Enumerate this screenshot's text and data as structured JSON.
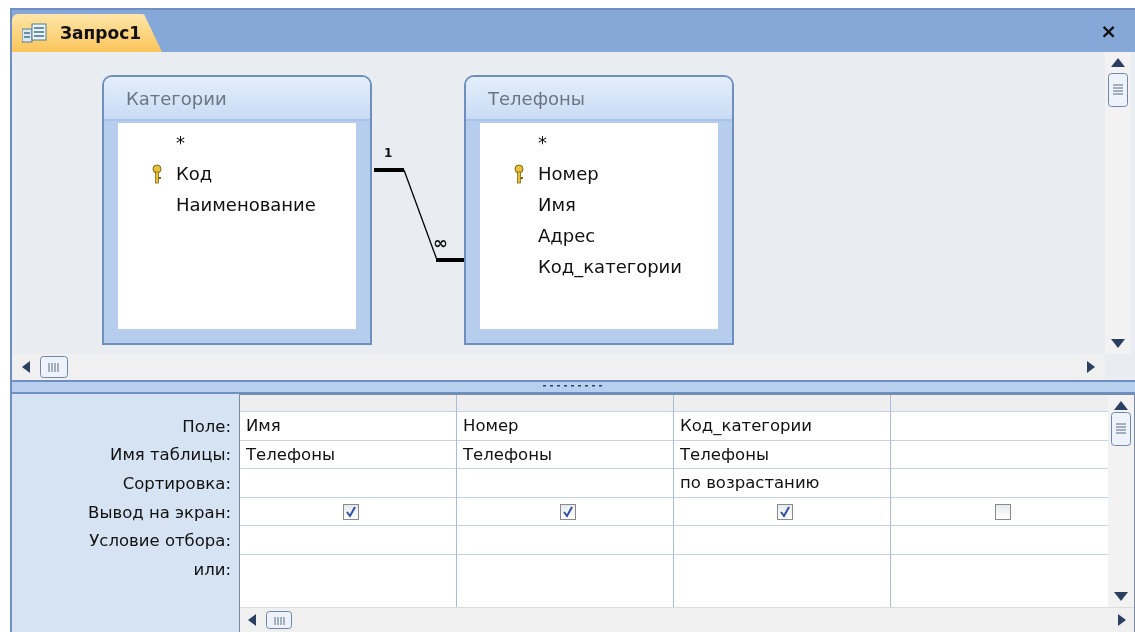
{
  "tab": {
    "title": "Запрос1",
    "selected": true
  },
  "close_button": "×",
  "tables": [
    {
      "title": "Категории",
      "fields": [
        {
          "name": "*",
          "primary_key": false
        },
        {
          "name": "Код",
          "primary_key": true
        },
        {
          "name": "Наименование",
          "primary_key": false
        }
      ]
    },
    {
      "title": "Телефоны",
      "fields": [
        {
          "name": "*",
          "primary_key": false
        },
        {
          "name": "Номер",
          "primary_key": true
        },
        {
          "name": "Имя",
          "primary_key": false
        },
        {
          "name": "Адрес",
          "primary_key": false
        },
        {
          "name": "Код_категории",
          "primary_key": false
        }
      ]
    }
  ],
  "relationship": {
    "one_label": "1",
    "many_label": "∞"
  },
  "grid": {
    "row_labels": [
      "Поле:",
      "Имя таблицы:",
      "Сортировка:",
      "Вывод на экран:",
      "Условие отбора:",
      "или:"
    ],
    "columns": [
      {
        "field": "Имя",
        "table": "Телефоны",
        "show": true
      },
      {
        "field": "Номер",
        "table": "Телефоны",
        "show": true
      },
      {
        "field": "Код_категории",
        "table": "Телефоны",
        "sort": "по возрастанию",
        "show": true
      },
      {
        "show": false
      }
    ]
  }
}
